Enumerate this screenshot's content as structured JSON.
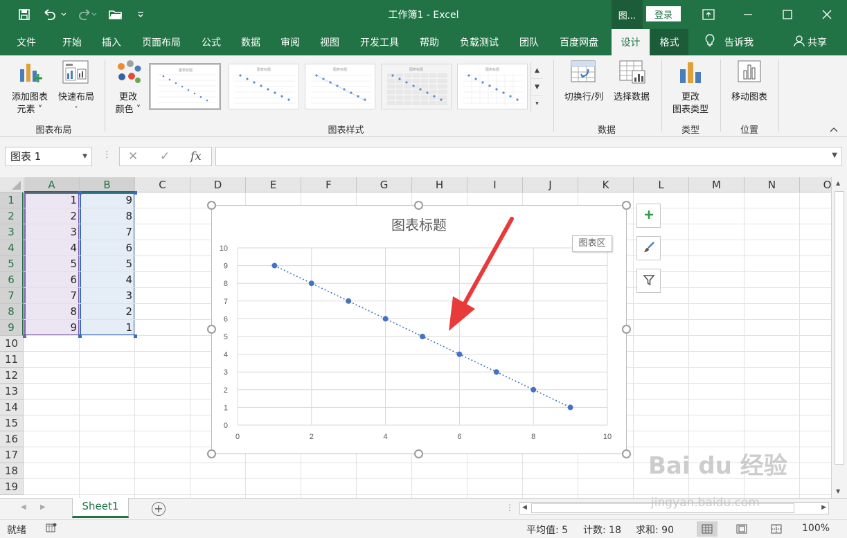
{
  "window": {
    "title": "工作簿1  -  Excel",
    "context_tab": "图...",
    "login": "登录"
  },
  "tabs": [
    {
      "label": "文件"
    },
    {
      "label": "开始"
    },
    {
      "label": "插入"
    },
    {
      "label": "页面布局"
    },
    {
      "label": "公式"
    },
    {
      "label": "数据"
    },
    {
      "label": "审阅"
    },
    {
      "label": "视图"
    },
    {
      "label": "开发工具"
    },
    {
      "label": "帮助"
    },
    {
      "label": "负载测试"
    },
    {
      "label": "团队"
    },
    {
      "label": "百度网盘"
    },
    {
      "label": "设计"
    },
    {
      "label": "格式"
    }
  ],
  "tell_me": "告诉我",
  "share": "共享",
  "ribbon": {
    "add_element_1": "添加图表",
    "add_element_2": "元素 ˅",
    "quick_layout_1": "快速布局",
    "quick_layout_2": "˅",
    "change_color_1": "更改",
    "change_color_2": "颜色 ˅",
    "switch_row_col": "切换行/列",
    "select_data": "选择数据",
    "change_type_1": "更改",
    "change_type_2": "图表类型",
    "move_chart": "移动图表",
    "groups": {
      "chart_layout": "图表布局",
      "chart_styles": "图表样式",
      "data": "数据",
      "type": "类型",
      "location": "位置"
    }
  },
  "formula_bar": {
    "name_box": "图表 1",
    "fx": "fx",
    "value": ""
  },
  "columns": [
    "A",
    "B",
    "C",
    "D",
    "E",
    "F",
    "G",
    "H",
    "I",
    "J",
    "K",
    "L",
    "M",
    "N",
    "O"
  ],
  "rows": [
    "1",
    "2",
    "3",
    "4",
    "5",
    "6",
    "7",
    "8",
    "9",
    "10",
    "11",
    "12",
    "13",
    "14",
    "15",
    "16",
    "17",
    "18",
    "19"
  ],
  "cells": {
    "A": [
      "1",
      "2",
      "3",
      "4",
      "5",
      "6",
      "7",
      "8",
      "9"
    ],
    "B": [
      "9",
      "8",
      "7",
      "6",
      "5",
      "4",
      "3",
      "2",
      "1"
    ]
  },
  "chart_data": {
    "type": "scatter",
    "title": "图表标题",
    "x": [
      1,
      2,
      3,
      4,
      5,
      6,
      7,
      8,
      9
    ],
    "y": [
      9,
      8,
      7,
      6,
      5,
      4,
      3,
      2,
      1
    ],
    "xlim": [
      0,
      10
    ],
    "ylim": [
      0,
      10
    ],
    "x_ticks": [
      "0",
      "2",
      "4",
      "6",
      "8",
      "10"
    ],
    "y_ticks": [
      "0",
      "1",
      "2",
      "3",
      "4",
      "5",
      "6",
      "7",
      "8",
      "9",
      "10"
    ],
    "trendline": "linear-dotted",
    "grid": true,
    "series_color": "#4472c4",
    "annotation": "red-arrow"
  },
  "chart_tooltip": "图表区",
  "sheet": {
    "tab": "Sheet1"
  },
  "status": {
    "ready": "就绪",
    "average": "平均值: 5",
    "count": "计数: 18",
    "sum": "求和: 90",
    "zoom": "100%"
  },
  "watermark": {
    "text": "Bai du 经验",
    "url": "jingyan.baidu.com"
  },
  "colors": {
    "accent": "#217346",
    "dark_accent": "#1d5c39",
    "marker": "#4472c4",
    "arrow": "#e83a3a"
  }
}
